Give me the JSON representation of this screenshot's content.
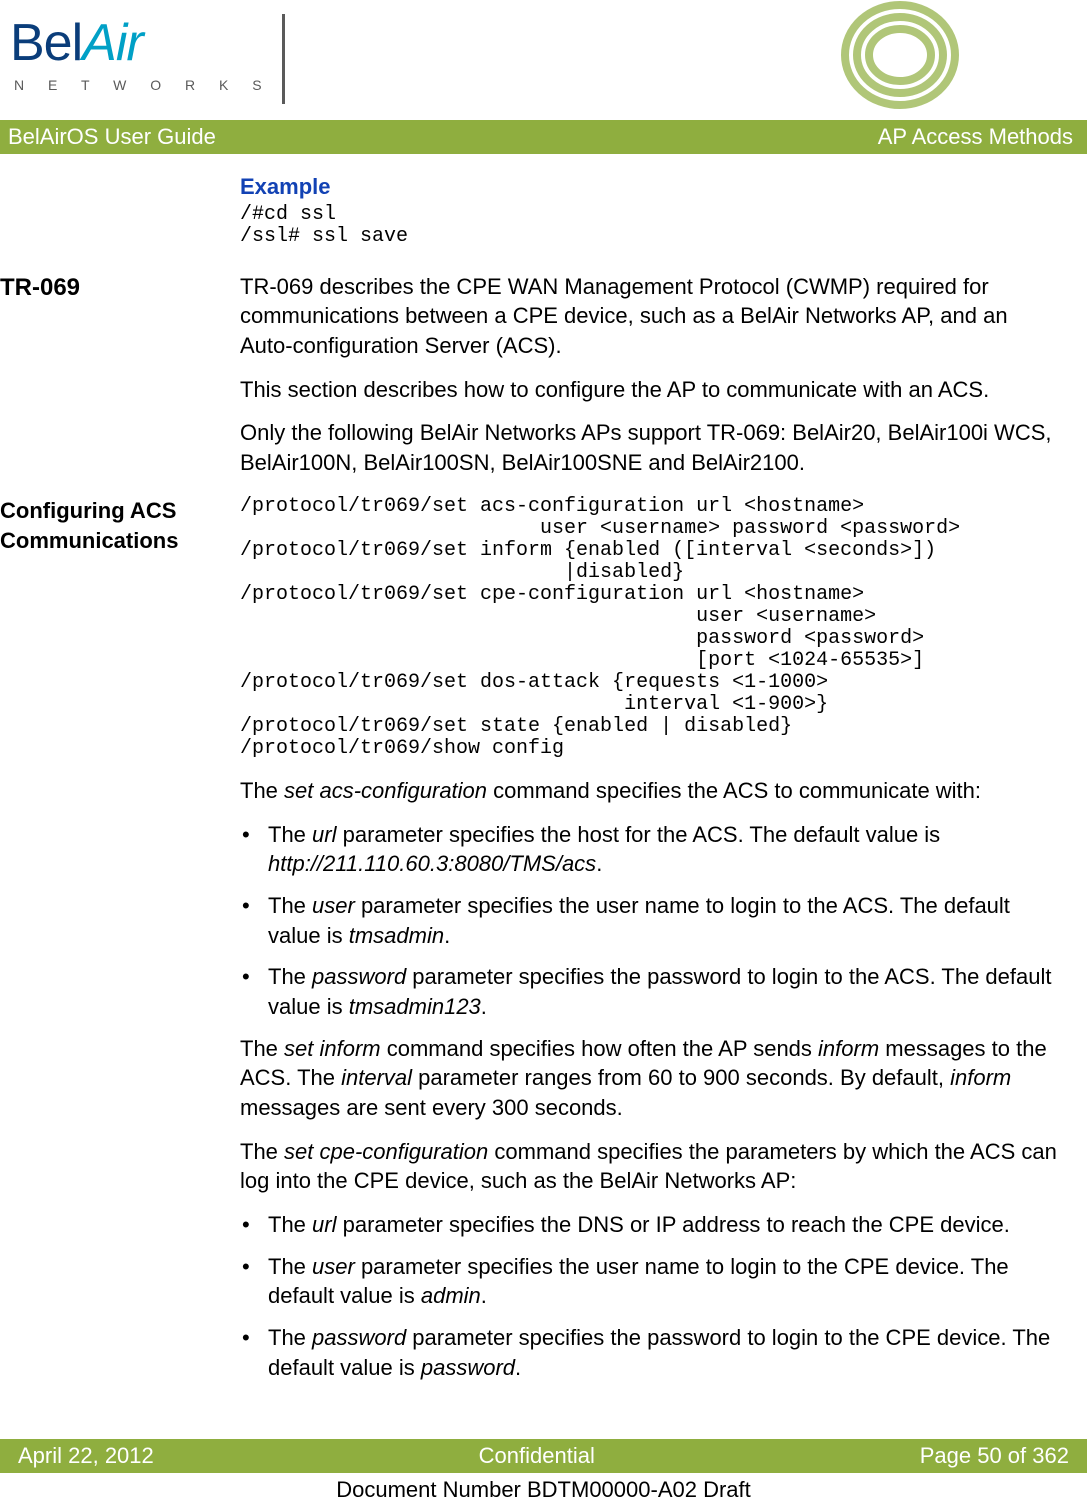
{
  "header": {
    "logo_bel": "Bel",
    "logo_air": "Air",
    "logo_sub": "N E T W O R K S",
    "guide_title": "BelAirOS User Guide",
    "chapter_title": "AP Access Methods"
  },
  "example": {
    "label": "Example",
    "code": "/#cd ssl\n/ssl# ssl save"
  },
  "tr069": {
    "heading": "TR-069",
    "p1": "TR-069 describes the CPE WAN Management Protocol (CWMP) required for communications between a CPE device, such as a BelAir Networks AP, and an Auto-configuration Server (ACS).",
    "p2": "This section describes how to configure the AP to communicate with an ACS.",
    "p3": "Only the following BelAir Networks APs support TR-069: BelAir20, BelAir100i WCS, BelAir100N, BelAir100SN, BelAir100SNE and BelAir2100."
  },
  "config_acs": {
    "heading": "Configuring ACS Communications",
    "code": "/protocol/tr069/set acs-configuration url <hostname>\n                         user <username> password <password>\n/protocol/tr069/set inform {enabled ([interval <seconds>])\n                           |disabled}\n/protocol/tr069/set cpe-configuration url <hostname>\n                                      user <username>\n                                      password <password>\n                                      [port <1024-65535>]\n/protocol/tr069/set dos-attack {requests <1-1000>\n                                interval <1-900>}\n/protocol/tr069/set state {enabled | disabled}\n/protocol/tr069/show config"
  },
  "body": {
    "acs_intro_pre": "The ",
    "acs_intro_cmd": "set acs-configuration",
    "acs_intro_post": " command specifies the ACS to communicate with:",
    "b1_pre": "The ",
    "b1_param": "url",
    "b1_mid": " parameter specifies the host for the ACS. The default value is ",
    "b1_val": "http://211.110.60.3:8080/TMS/acs",
    "b1_end": ".",
    "b2_pre": "The ",
    "b2_param": "user",
    "b2_mid": " parameter specifies the user name to login to the ACS. The default value is ",
    "b2_val": "tmsadmin",
    "b2_end": ".",
    "b3_pre": "The ",
    "b3_param": "password",
    "b3_mid": " parameter specifies the password to login to the ACS. The default value is ",
    "b3_val": "tmsadmin123",
    "b3_end": ".",
    "inform_pre": "The ",
    "inform_cmd": "set inform",
    "inform_mid1": " command specifies how often the AP sends ",
    "inform_w1": "inform",
    "inform_mid2": " messages to the ACS. The ",
    "inform_w2": "interval",
    "inform_mid3": " parameter ranges from 60 to 900 seconds. By default, ",
    "inform_w3": "inform",
    "inform_end": " messages are sent every 300 seconds.",
    "cpe_pre": "The ",
    "cpe_cmd": "set cpe-configuration",
    "cpe_post": " command specifies the parameters by which the ACS can log into the CPE device, such as the BelAir Networks AP:",
    "c1_pre": "The ",
    "c1_param": "url",
    "c1_post": " parameter specifies the DNS or IP address to reach the CPE device.",
    "c2_pre": "The ",
    "c2_param": "user",
    "c2_mid": " parameter specifies the user name to login to the CPE device. The default value is ",
    "c2_val": "admin",
    "c2_end": ".",
    "c3_pre": "The ",
    "c3_param": "password",
    "c3_mid": " parameter specifies the password to login to the CPE device. The default value is ",
    "c3_val": "password",
    "c3_end": "."
  },
  "footer": {
    "date": "April 22, 2012",
    "conf": "Confidential",
    "page": "Page 50 of 362",
    "docnum": "Document Number BDTM00000-A02 Draft"
  }
}
